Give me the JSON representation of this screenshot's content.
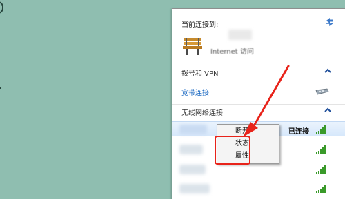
{
  "panel": {
    "connected_to_label": "当前连接到:",
    "internet_access": "Internet 访问",
    "dialup_section": "拨号和 VPN",
    "broadband_label": "宽带连接",
    "wireless_section": "无线网络连接",
    "connected_status": "已连接"
  },
  "context_menu": {
    "items": [
      "断开",
      "状态",
      "属性"
    ]
  },
  "colors": {
    "desktop_bg": "#8fbeb0",
    "link_blue": "#1565c0",
    "annotation_red": "#e8231a",
    "signal_green": "#3a9a2a"
  },
  "icons": {
    "refresh": "refresh-arrows-icon",
    "network": "bench-network-icon",
    "dialup": "dialup-modem-icon",
    "signal": "wifi-signal-icon",
    "caret": "chevron-up-icon"
  }
}
